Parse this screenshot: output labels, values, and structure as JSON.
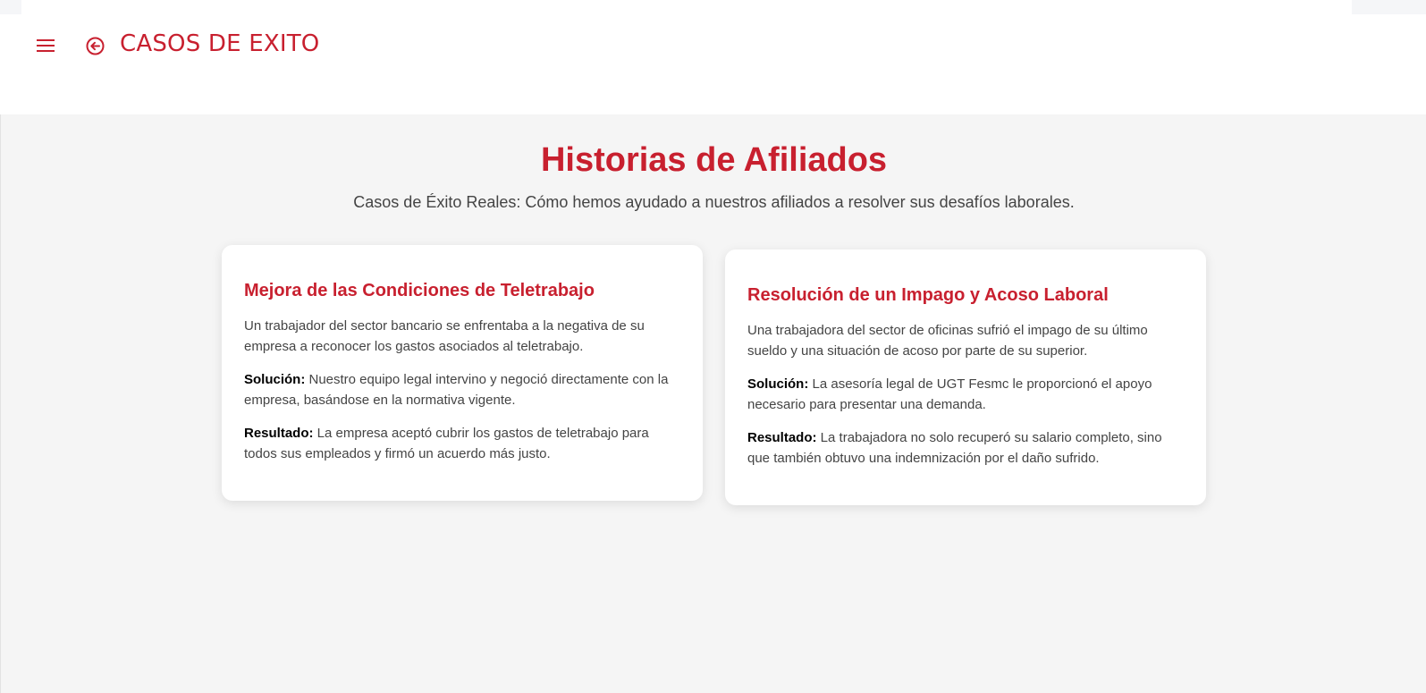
{
  "header": {
    "title": "CASOS DE EXITO",
    "menu_icon": "hamburger-menu-icon",
    "back_icon": "circle-arrow-left-icon",
    "accent_color": "#c8202f"
  },
  "main": {
    "title": "Historias de Afiliados",
    "subtitle": "Casos de Éxito Reales: Cómo hemos ayudado a nuestros afiliados a resolver sus desafíos laborales.",
    "background_color": "#f5f5f5",
    "cards": [
      {
        "title": "Mejora de las Condiciones de Teletrabajo",
        "description": "Un trabajador del sector bancario se enfrentaba a la negativa de su empresa a reconocer los gastos asociados al teletrabajo.",
        "solution_label": "Solución:",
        "solution_text": " Nuestro equipo legal intervino y negoció directamente con la empresa, basándose en la normativa vigente.",
        "result_label": "Resultado:",
        "result_text": " La empresa aceptó cubrir los gastos de teletrabajo para todos sus empleados y firmó un acuerdo más justo."
      },
      {
        "title": "Resolución de un Impago y Acoso Laboral",
        "description": "Una trabajadora del sector de oficinas sufrió el impago de su último sueldo y una situación de acoso por parte de su superior.",
        "solution_label": "Solución:",
        "solution_text": " La asesoría legal de UGT Fesmc le proporcionó el apoyo necesario para presentar una demanda.",
        "result_label": "Resultado:",
        "result_text": " La trabajadora no solo recuperó su salario completo, sino que también obtuvo una indemnización por el daño sufrido."
      }
    ]
  }
}
